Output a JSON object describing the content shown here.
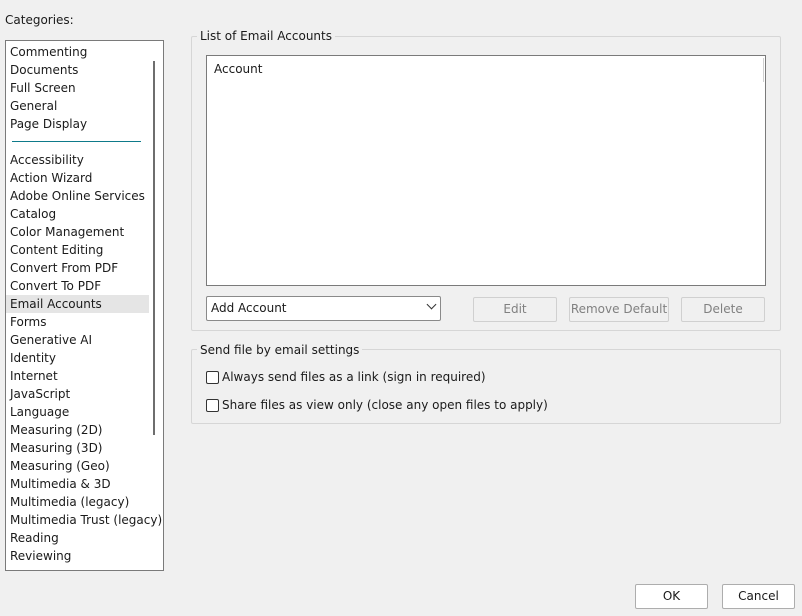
{
  "categories_label": "Categories:",
  "categories_top": [
    "Commenting",
    "Documents",
    "Full Screen",
    "General",
    "Page Display"
  ],
  "categories": [
    "Accessibility",
    "Action Wizard",
    "Adobe Online Services",
    "Catalog",
    "Color Management",
    "Content Editing",
    "Convert From PDF",
    "Convert To PDF",
    "Email Accounts",
    "Forms",
    "Generative AI",
    "Identity",
    "Internet",
    "JavaScript",
    "Language",
    "Measuring (2D)",
    "Measuring (3D)",
    "Measuring (Geo)",
    "Multimedia & 3D",
    "Multimedia (legacy)",
    "Multimedia Trust (legacy)",
    "Reading",
    "Reviewing"
  ],
  "selected_category": "Email Accounts",
  "email_accounts": {
    "group_title": "List of Email Accounts",
    "list_header": "Account",
    "add_account": "Add Account",
    "edit": "Edit",
    "remove_default": "Remove Default",
    "delete": "Delete"
  },
  "send_settings": {
    "group_title": "Send file by email settings",
    "always_link": "Always send files as a link (sign in required)",
    "view_only": "Share files as view only (close any open files to apply)"
  },
  "footer": {
    "ok": "OK",
    "cancel": "Cancel"
  }
}
